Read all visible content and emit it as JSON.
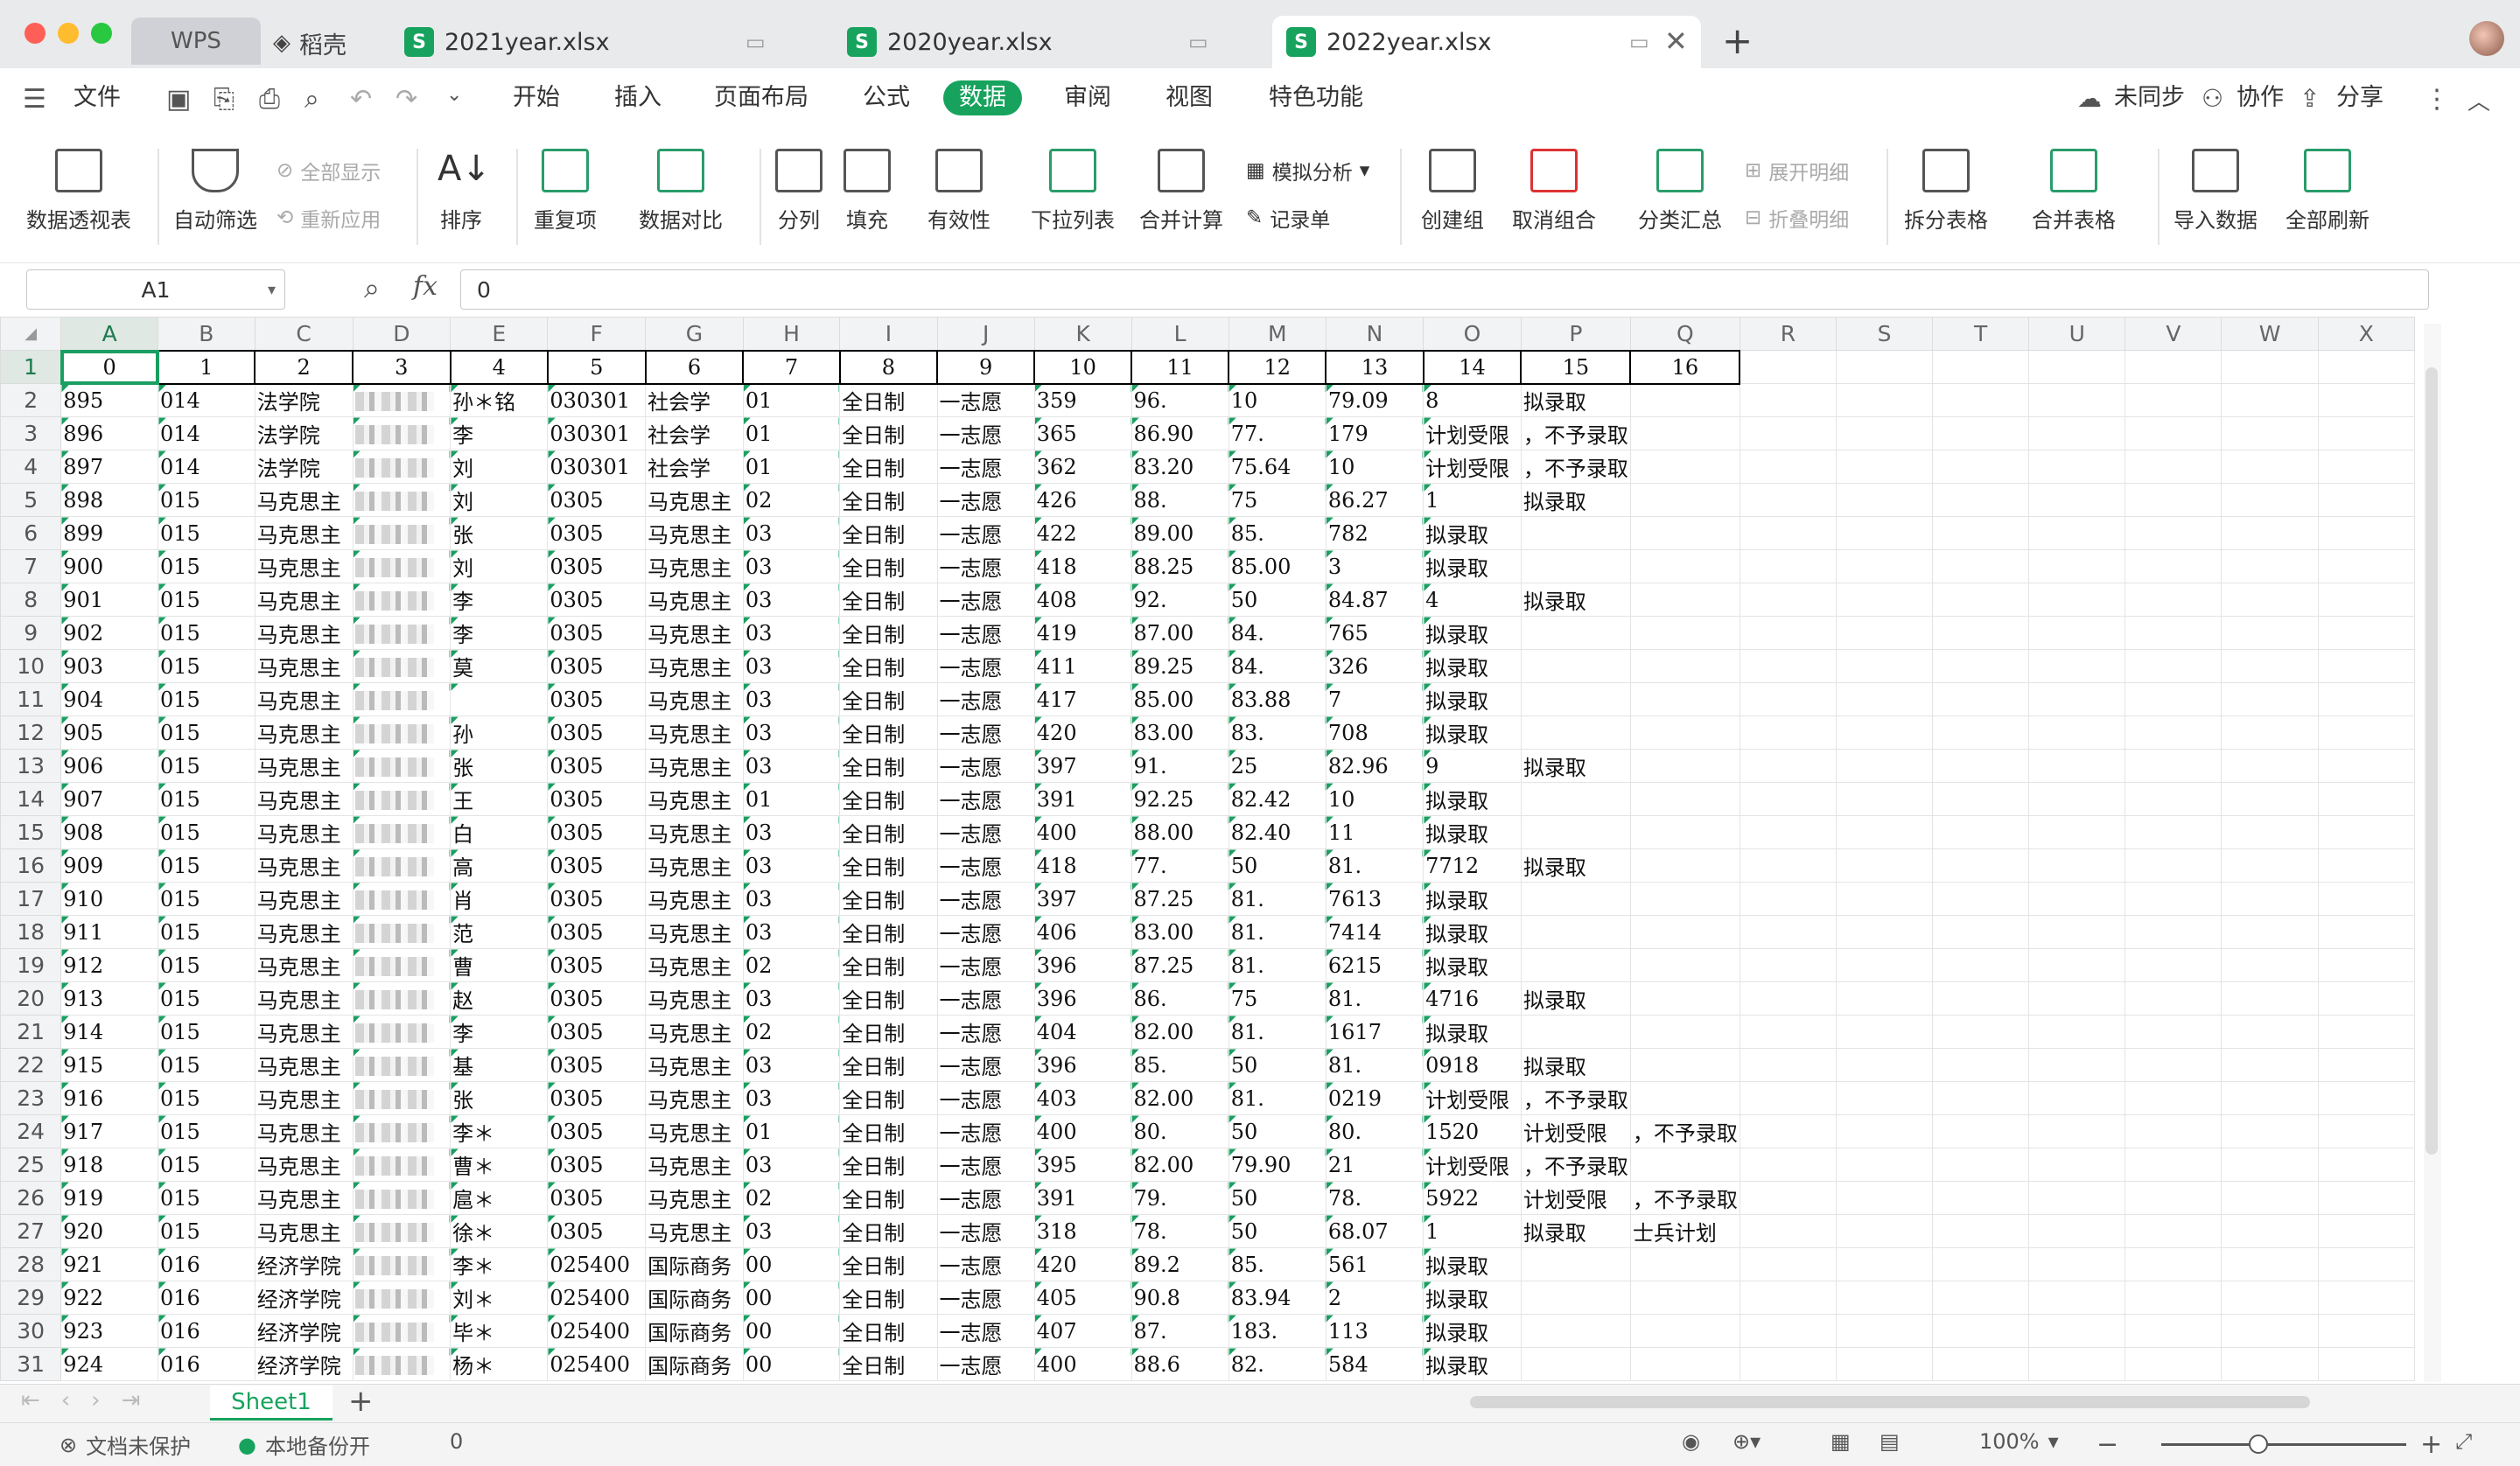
{
  "tabs": {
    "wps": "WPS",
    "daoke": "稻壳",
    "files": [
      "2021year.xlsx",
      "2020year.xlsx",
      "2022year.xlsx"
    ]
  },
  "menu": {
    "file": "文件",
    "items": [
      "开始",
      "插入",
      "页面布局",
      "公式",
      "数据",
      "审阅",
      "视图",
      "特色功能"
    ],
    "right": [
      "未同步",
      "协作",
      "分享"
    ]
  },
  "ribbon": {
    "big": [
      "数据透视表",
      "自动筛选",
      "排序",
      "重复项",
      "数据对比",
      "分列",
      "填充",
      "有效性",
      "下拉列表",
      "合并计算",
      "创建组",
      "取消组合",
      "分类汇总",
      "拆分表格",
      "合并表格",
      "导入数据",
      "全部刷新"
    ],
    "small": [
      "全部显示",
      "重新应用",
      "模拟分析",
      "记录单",
      "展开明细",
      "折叠明细"
    ]
  },
  "formula": {
    "cell": "A1",
    "fx": "fx",
    "value": "0"
  },
  "columns": [
    "A",
    "B",
    "C",
    "D",
    "E",
    "F",
    "G",
    "H",
    "I",
    "J",
    "K",
    "L",
    "M",
    "N",
    "O",
    "P",
    "Q",
    "R",
    "S",
    "T",
    "U",
    "V",
    "W",
    "X"
  ],
  "rows": [
    [
      "0",
      "1",
      "2",
      "3",
      "4",
      "5",
      "6",
      "7",
      "8",
      "9",
      "10",
      "11",
      "12",
      "13",
      "14",
      "15",
      "16"
    ],
    [
      "895",
      "014",
      "法学院",
      "",
      "孙＊铭",
      "030301",
      "社会学",
      "01",
      "全日制",
      "一志愿",
      "359",
      "96.",
      "10",
      "79.09",
      "8",
      "拟录取",
      ""
    ],
    [
      "896",
      "014",
      "法学院",
      "",
      "李",
      "030301",
      "社会学",
      "01",
      "全日制",
      "一志愿",
      "365",
      "86.90",
      "77.",
      "179",
      "计划受限",
      "，不予录取",
      ""
    ],
    [
      "897",
      "014",
      "法学院",
      "",
      "刘",
      "030301",
      "社会学",
      "01",
      "全日制",
      "一志愿",
      "362",
      "83.20",
      "75.64",
      "10",
      "计划受限",
      "，不予录取",
      ""
    ],
    [
      "898",
      "015",
      "马克思主",
      "",
      "刘",
      "0305",
      "马克思主",
      "02",
      "全日制",
      "一志愿",
      "426",
      "88.",
      "75",
      "86.27",
      "1",
      "拟录取",
      ""
    ],
    [
      "899",
      "015",
      "马克思主",
      "",
      "张",
      "0305",
      "马克思主",
      "03",
      "全日制",
      "一志愿",
      "422",
      "89.00",
      "85.",
      "782",
      "拟录取",
      "",
      ""
    ],
    [
      "900",
      "015",
      "马克思主",
      "",
      "刘",
      "0305",
      "马克思主",
      "03",
      "全日制",
      "一志愿",
      "418",
      "88.25",
      "85.00",
      "3",
      "拟录取",
      "",
      ""
    ],
    [
      "901",
      "015",
      "马克思主",
      "",
      "李",
      "0305",
      "马克思主",
      "03",
      "全日制",
      "一志愿",
      "408",
      "92.",
      "50",
      "84.87",
      "4",
      "拟录取",
      ""
    ],
    [
      "902",
      "015",
      "马克思主",
      "",
      "李",
      "0305",
      "马克思主",
      "03",
      "全日制",
      "一志愿",
      "419",
      "87.00",
      "84.",
      "765",
      "拟录取",
      "",
      ""
    ],
    [
      "903",
      "015",
      "马克思主",
      "",
      "莫",
      "0305",
      "马克思主",
      "03",
      "全日制",
      "一志愿",
      "411",
      "89.25",
      "84.",
      "326",
      "拟录取",
      "",
      ""
    ],
    [
      "904",
      "015",
      "马克思主",
      "",
      "",
      "0305",
      "马克思主",
      "03",
      "全日制",
      "一志愿",
      "417",
      "85.00",
      "83.88",
      "7",
      "拟录取",
      "",
      ""
    ],
    [
      "905",
      "015",
      "马克思主",
      "",
      "孙",
      "0305",
      "马克思主",
      "03",
      "全日制",
      "一志愿",
      "420",
      "83.00",
      "83.",
      "708",
      "拟录取",
      "",
      ""
    ],
    [
      "906",
      "015",
      "马克思主",
      "",
      "张",
      "0305",
      "马克思主",
      "03",
      "全日制",
      "一志愿",
      "397",
      "91.",
      "25",
      "82.96",
      "9",
      "拟录取",
      ""
    ],
    [
      "907",
      "015",
      "马克思主",
      "",
      "王",
      "0305",
      "马克思主",
      "01",
      "全日制",
      "一志愿",
      "391",
      "92.25",
      "82.42",
      "10",
      "拟录取",
      "",
      ""
    ],
    [
      "908",
      "015",
      "马克思主",
      "",
      "白",
      "0305",
      "马克思主",
      "03",
      "全日制",
      "一志愿",
      "400",
      "88.00",
      "82.40",
      "11",
      "拟录取",
      "",
      ""
    ],
    [
      "909",
      "015",
      "马克思主",
      "",
      "高",
      "0305",
      "马克思主",
      "03",
      "全日制",
      "一志愿",
      "418",
      "77.",
      "50",
      "81.",
      "7712",
      "拟录取",
      ""
    ],
    [
      "910",
      "015",
      "马克思主",
      "",
      "肖",
      "0305",
      "马克思主",
      "03",
      "全日制",
      "一志愿",
      "397",
      "87.25",
      "81.",
      "7613",
      "拟录取",
      "",
      ""
    ],
    [
      "911",
      "015",
      "马克思主",
      "",
      "范",
      "0305",
      "马克思主",
      "03",
      "全日制",
      "一志愿",
      "406",
      "83.00",
      "81.",
      "7414",
      "拟录取",
      "",
      ""
    ],
    [
      "912",
      "015",
      "马克思主",
      "",
      "曹",
      "0305",
      "马克思主",
      "02",
      "全日制",
      "一志愿",
      "396",
      "87.25",
      "81.",
      "6215",
      "拟录取",
      "",
      ""
    ],
    [
      "913",
      "015",
      "马克思主",
      "",
      "赵",
      "0305",
      "马克思主",
      "03",
      "全日制",
      "一志愿",
      "396",
      "86.",
      "75",
      "81.",
      "4716",
      "拟录取",
      ""
    ],
    [
      "914",
      "015",
      "马克思主",
      "",
      "李",
      "0305",
      "马克思主",
      "02",
      "全日制",
      "一志愿",
      "404",
      "82.00",
      "81.",
      "1617",
      "拟录取",
      "",
      ""
    ],
    [
      "915",
      "015",
      "马克思主",
      "",
      "基",
      "0305",
      "马克思主",
      "03",
      "全日制",
      "一志愿",
      "396",
      "85.",
      "50",
      "81.",
      "0918",
      "拟录取",
      ""
    ],
    [
      "916",
      "015",
      "马克思主",
      "",
      "张",
      "0305",
      "马克思主",
      "03",
      "全日制",
      "一志愿",
      "403",
      "82.00",
      "81.",
      "0219",
      "计划受限",
      "，不予录取",
      ""
    ],
    [
      "917",
      "015",
      "马克思主",
      "",
      "李＊",
      "0305",
      "马克思主",
      "01",
      "全日制",
      "一志愿",
      "400",
      "80.",
      "50",
      "80.",
      "1520",
      "计划受限",
      "，不予录取"
    ],
    [
      "918",
      "015",
      "马克思主",
      "",
      "曹＊",
      "0305",
      "马克思主",
      "03",
      "全日制",
      "一志愿",
      "395",
      "82.00",
      "79.90",
      "21",
      "计划受限",
      "，不予录取",
      ""
    ],
    [
      "919",
      "015",
      "马克思主",
      "",
      "扈＊",
      "0305",
      "马克思主",
      "02",
      "全日制",
      "一志愿",
      "391",
      "79.",
      "50",
      "78.",
      "5922",
      "计划受限",
      "，不予录取"
    ],
    [
      "920",
      "015",
      "马克思主",
      "",
      "徐＊",
      "0305",
      "马克思主",
      "03",
      "全日制",
      "一志愿",
      "318",
      "78.",
      "50",
      "68.07",
      "1",
      "拟录取",
      "士兵计划"
    ],
    [
      "921",
      "016",
      "经济学院",
      "",
      "李＊",
      "025400",
      "国际商务",
      "00",
      "全日制",
      "一志愿",
      "420",
      "89.2",
      "85.",
      "561",
      "拟录取",
      "",
      ""
    ],
    [
      "922",
      "016",
      "经济学院",
      "",
      "刘＊",
      "025400",
      "国际商务",
      "00",
      "全日制",
      "一志愿",
      "405",
      "90.8",
      "83.94",
      "2",
      "拟录取",
      "",
      ""
    ],
    [
      "923",
      "016",
      "经济学院",
      "",
      "毕＊",
      "025400",
      "国际商务",
      "00",
      "全日制",
      "一志愿",
      "407",
      "87.",
      "183.",
      "113",
      "拟录取",
      "",
      ""
    ],
    [
      "924",
      "016",
      "经济学院",
      "",
      "杨＊",
      "025400",
      "国际商务",
      "00",
      "全日制",
      "一志愿",
      "400",
      "88.6",
      "82.",
      "584",
      "拟录取",
      "",
      ""
    ]
  ],
  "sheet": {
    "name": "Sheet1"
  },
  "status": {
    "protect": "文档未保护",
    "backup": "本地备份开",
    "count": "0",
    "zoom": "100%"
  },
  "colors": {
    "accent": "#17a35e"
  }
}
